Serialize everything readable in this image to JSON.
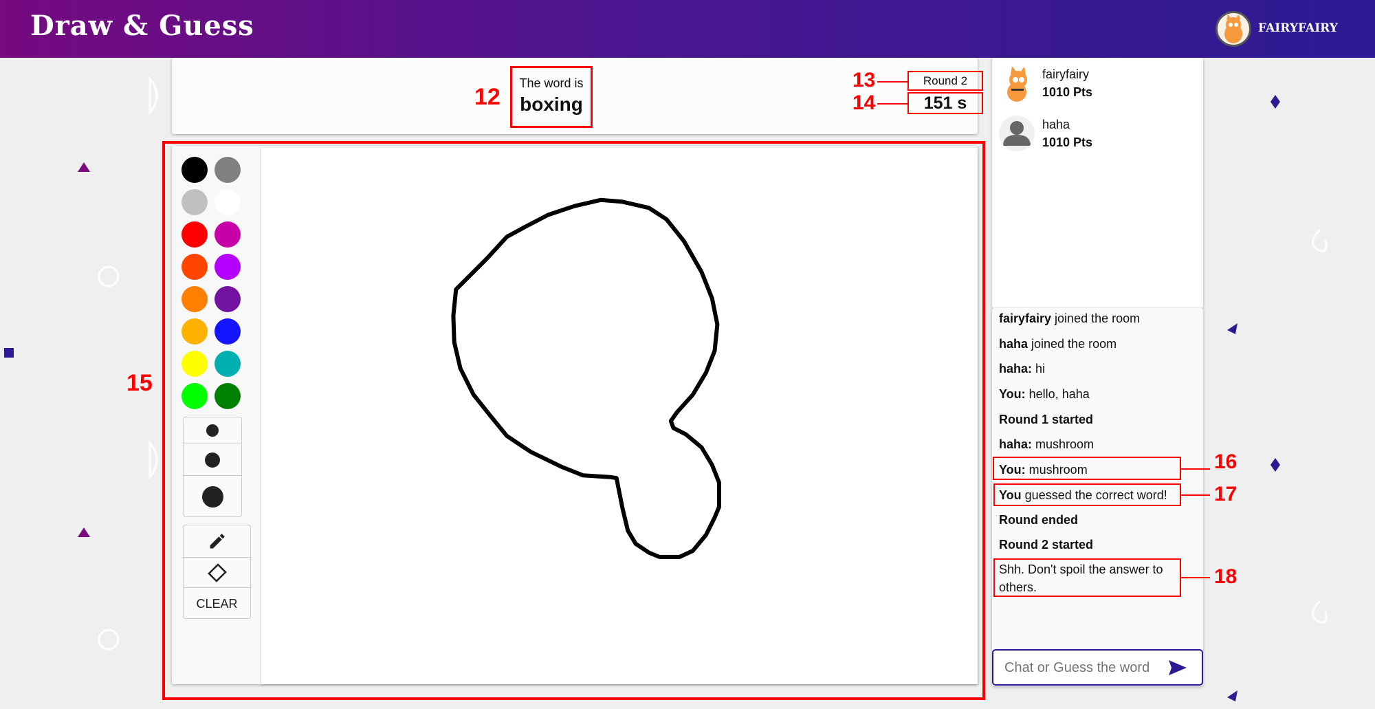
{
  "header": {
    "title": "Draw & Guess",
    "username": "FAIRYFAIRY"
  },
  "word_panel": {
    "label": "The word is",
    "word": "boxing",
    "round": "Round 2",
    "timer": "151 s"
  },
  "players": [
    {
      "name": "fairyfairy",
      "points": "1010 Pts",
      "avatar": "cat-avatar"
    },
    {
      "name": "haha",
      "points": "1010 Pts",
      "avatar": "default-person-avatar"
    }
  ],
  "palette": [
    "#000000",
    "#808080",
    "#c0c0c0",
    "#ffffff",
    "#ff0000",
    "#c800a8",
    "#ff4500",
    "#b400ff",
    "#ff7f00",
    "#7212a0",
    "#ffb300",
    "#1414ff",
    "#ffff00",
    "#00b0b0",
    "#00ff00",
    "#008000"
  ],
  "tools": {
    "clear_label": "CLEAR",
    "pencil": "pencil-icon",
    "eraser": "eraser-icon"
  },
  "chat": {
    "messages": [
      {
        "bold": "fairyfairy",
        "text": " joined the room"
      },
      {
        "bold": "haha",
        "text": " joined the room"
      },
      {
        "bold": "haha:",
        "text": " hi"
      },
      {
        "bold": "You:",
        "text": " hello, haha"
      },
      {
        "bold": "Round 1 started",
        "text": ""
      },
      {
        "bold": "haha:",
        "text": " mushroom"
      },
      {
        "bold": "You:",
        "text": " mushroom"
      },
      {
        "bold": "You",
        "text": " guessed the correct word!"
      },
      {
        "bold": "Round ended",
        "text": ""
      },
      {
        "bold": "Round 2 started",
        "text": ""
      },
      {
        "bold": "",
        "text": "Shh. Don't spoil the answer to others."
      }
    ],
    "placeholder": "Chat or Guess the word"
  },
  "annotations": {
    "a12": "12",
    "a13": "13",
    "a14": "14",
    "a15": "15",
    "a16": "16",
    "a17": "17",
    "a18": "18"
  },
  "colors": {
    "accent": "#2c1b93",
    "header_start": "#760a80",
    "annotation": "#ff0000"
  }
}
